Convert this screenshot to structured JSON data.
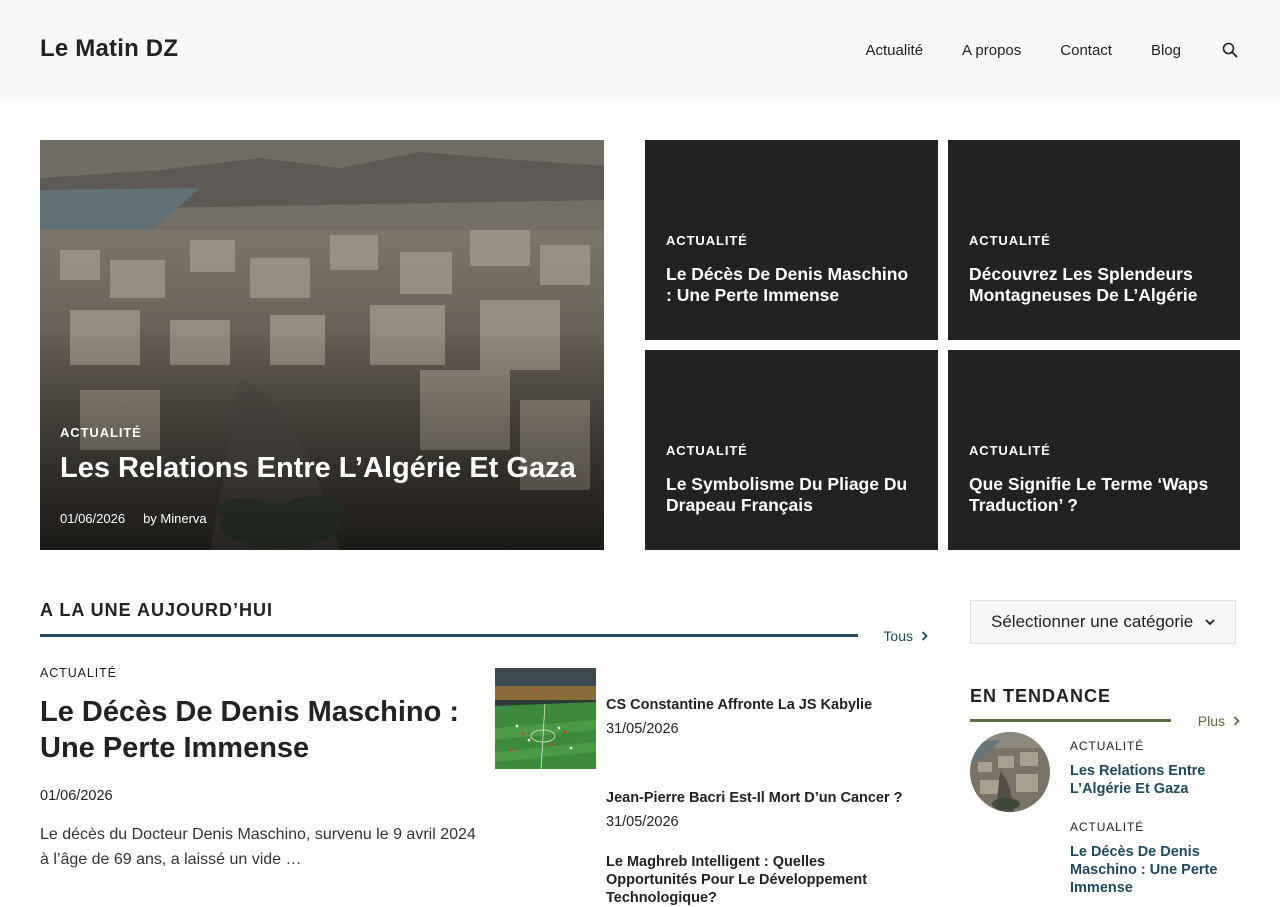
{
  "site": {
    "title": "Le Matin DZ"
  },
  "nav": {
    "items": [
      "Actualité",
      "A propos",
      "Contact",
      "Blog"
    ],
    "search_icon": "search-icon"
  },
  "hero": {
    "main": {
      "category": "ACTUALITÉ",
      "title": "Les Relations Entre L’Algérie Et Gaza",
      "date": "01/06/2026",
      "author": "by Minerva"
    },
    "tiles": [
      {
        "category": "ACTUALITÉ",
        "title": "Le Décès De Denis Maschino : Une Perte Immense"
      },
      {
        "category": "ACTUALITÉ",
        "title": "Découvrez Les Splendeurs Montagneuses De L’Algérie"
      },
      {
        "category": "ACTUALITÉ",
        "title": "Le Symbolisme Du Pliage Du Drapeau Français"
      },
      {
        "category": "ACTUALITÉ",
        "title": "Que Signifie Le Terme ‘Waps Traduction’ ?"
      }
    ]
  },
  "section": {
    "title": "A LA UNE AUJOURD’HUI",
    "more_label": "Tous",
    "accent_color": "#1f4a5c",
    "feature": {
      "category": "ACTUALITÉ",
      "title": "Le Décès De Denis Maschino : Une Perte Immense",
      "date": "01/06/2026",
      "excerpt": "Le décès du Docteur Denis Maschino, survenu le 9 avril 2024 à l’âge de 69 ans, a laissé un vide …"
    },
    "list": [
      {
        "title": "CS Constantine Affronte La JS Kabylie",
        "date": "31/05/2026"
      },
      {
        "title": "Jean-Pierre Bacri Est-Il Mort D’un Cancer ?",
        "date": "31/05/2026"
      },
      {
        "title": "Le Maghreb Intelligent : Quelles Opportunités Pour Le Développement Technologique?"
      }
    ]
  },
  "sidebar": {
    "category_select": "Sélectionner une catégorie",
    "trending": {
      "title": "EN TENDANCE",
      "more_label": "Plus",
      "accent_color": "#5a6e3e",
      "items": [
        {
          "category": "ACTUALITÉ",
          "title": "Les Relations Entre L’Algérie Et Gaza"
        },
        {
          "category": "ACTUALITÉ",
          "title": "Le Décès De Denis Maschino : Une Perte Immense"
        }
      ]
    }
  }
}
